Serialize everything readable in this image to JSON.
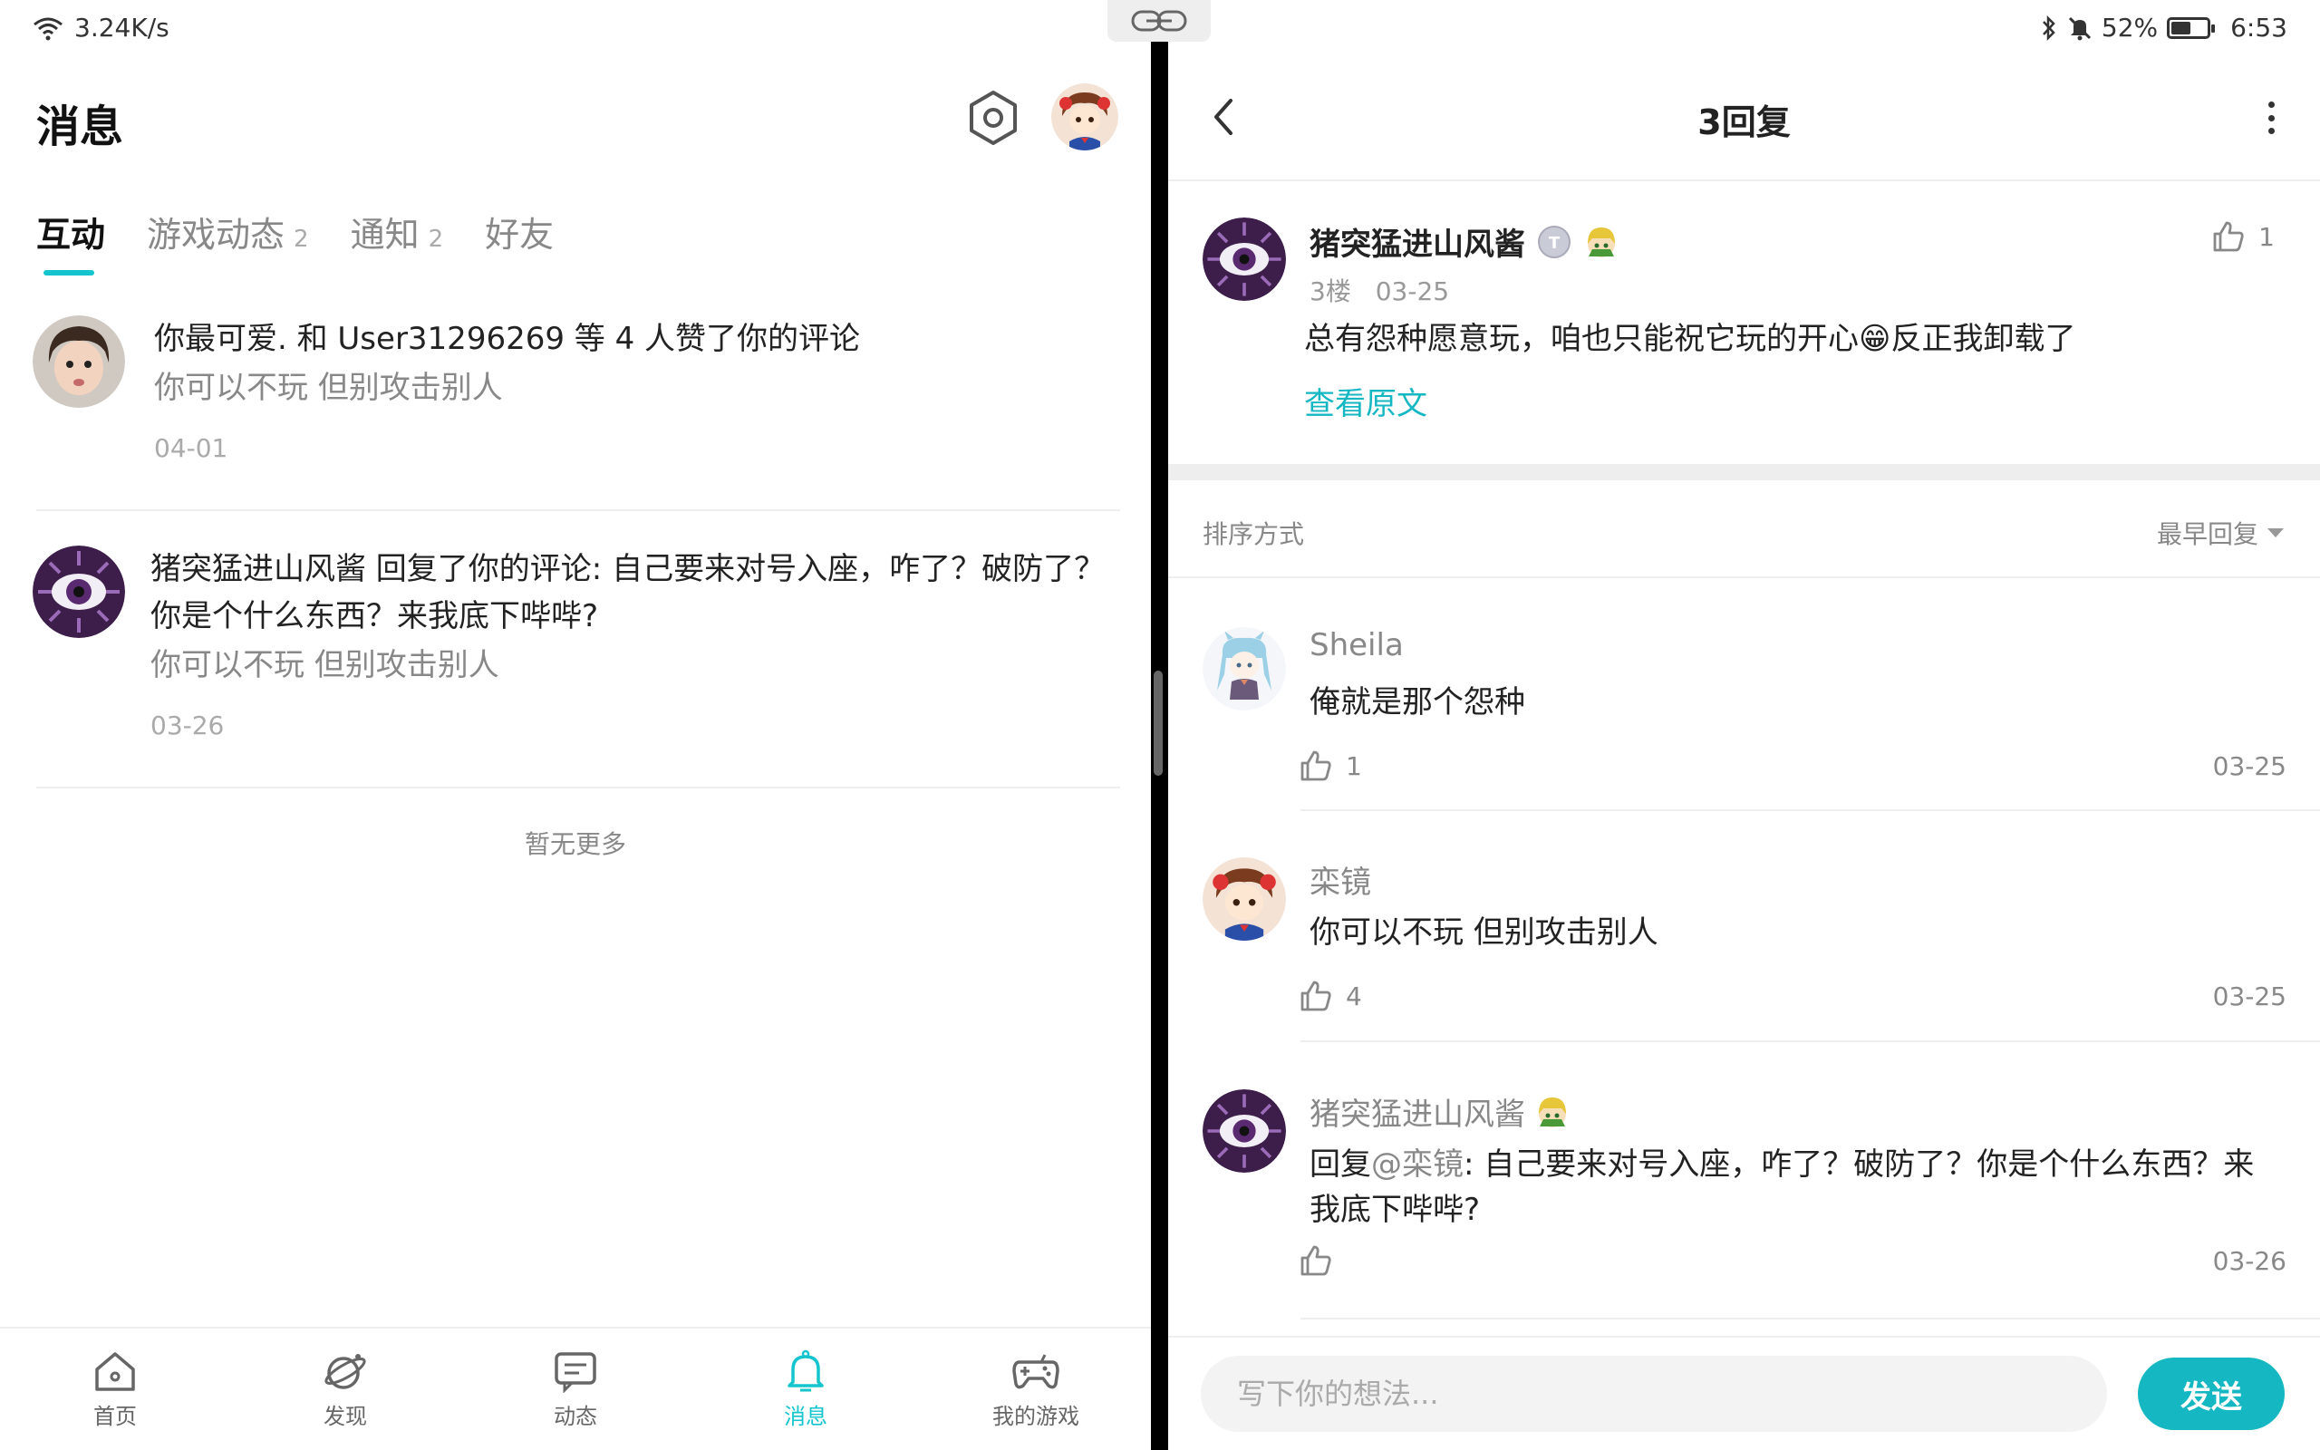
{
  "status_bar": {
    "network_speed": "3.24K/s",
    "battery_percent": "52%",
    "battery_level": 0.52,
    "time": "6:53",
    "icons": [
      "wifi-icon",
      "bluetooth-icon",
      "mute-icon",
      "battery-icon"
    ]
  },
  "left_pane": {
    "title": "消息",
    "tabs": [
      {
        "label": "互动",
        "badge": "",
        "active": true
      },
      {
        "label": "游戏动态",
        "badge": "2",
        "active": false
      },
      {
        "label": "通知",
        "badge": "2",
        "active": false
      },
      {
        "label": "好友",
        "badge": "",
        "active": false
      }
    ],
    "messages": [
      {
        "title": "你最可爱. 和 User31296269 等 4 人赞了你的评论",
        "quote": "你可以不玩 但别攻击别人",
        "date": "04-01"
      },
      {
        "title": "猪突猛进山风酱 回复了你的评论: 自己要来对号入座，咋了？破防了？你是个什么东西？来我底下哔哔?",
        "quote": "你可以不玩 但别攻击别人",
        "date": "03-26"
      }
    ],
    "no_more": "暂无更多",
    "bottom_nav": [
      {
        "label": "首页",
        "icon": "home-icon",
        "active": false
      },
      {
        "label": "发现",
        "icon": "discover-icon",
        "active": false
      },
      {
        "label": "动态",
        "icon": "feed-icon",
        "active": false
      },
      {
        "label": "消息",
        "icon": "bell-icon",
        "active": true
      },
      {
        "label": "我的游戏",
        "icon": "gamepad-icon",
        "active": false
      }
    ]
  },
  "right_pane": {
    "title": "3回复",
    "original": {
      "author": "猪突猛进山风酱",
      "floor": "3楼",
      "date": "03-25",
      "text": "总有怨种愿意玩，咱也只能祝它玩的开心😁反正我卸载了",
      "view_original": "查看原文",
      "likes": "1"
    },
    "sort": {
      "label": "排序方式",
      "selected": "最早回复"
    },
    "replies": [
      {
        "author": "Sheila",
        "text": "俺就是那个怨种",
        "mention": "",
        "likes": "1",
        "date": "03-25"
      },
      {
        "author": "栾镜",
        "text": "你可以不玩 但别攻击别人",
        "mention": "",
        "likes": "4",
        "date": "03-25"
      },
      {
        "author": "猪突猛进山风酱",
        "prefix": "回复",
        "mention": "@栾镜",
        "text": ": 自己要来对号入座，咋了？破防了？你是个什么东西？来我底下哔哔?",
        "likes": "",
        "date": "03-26"
      }
    ],
    "composer": {
      "placeholder": "写下你的想法...",
      "send_label": "发送"
    }
  },
  "colors": {
    "accent": "#15c5ce",
    "link": "#15b7c2",
    "muted": "#888888",
    "divider": "#eeeeee"
  }
}
